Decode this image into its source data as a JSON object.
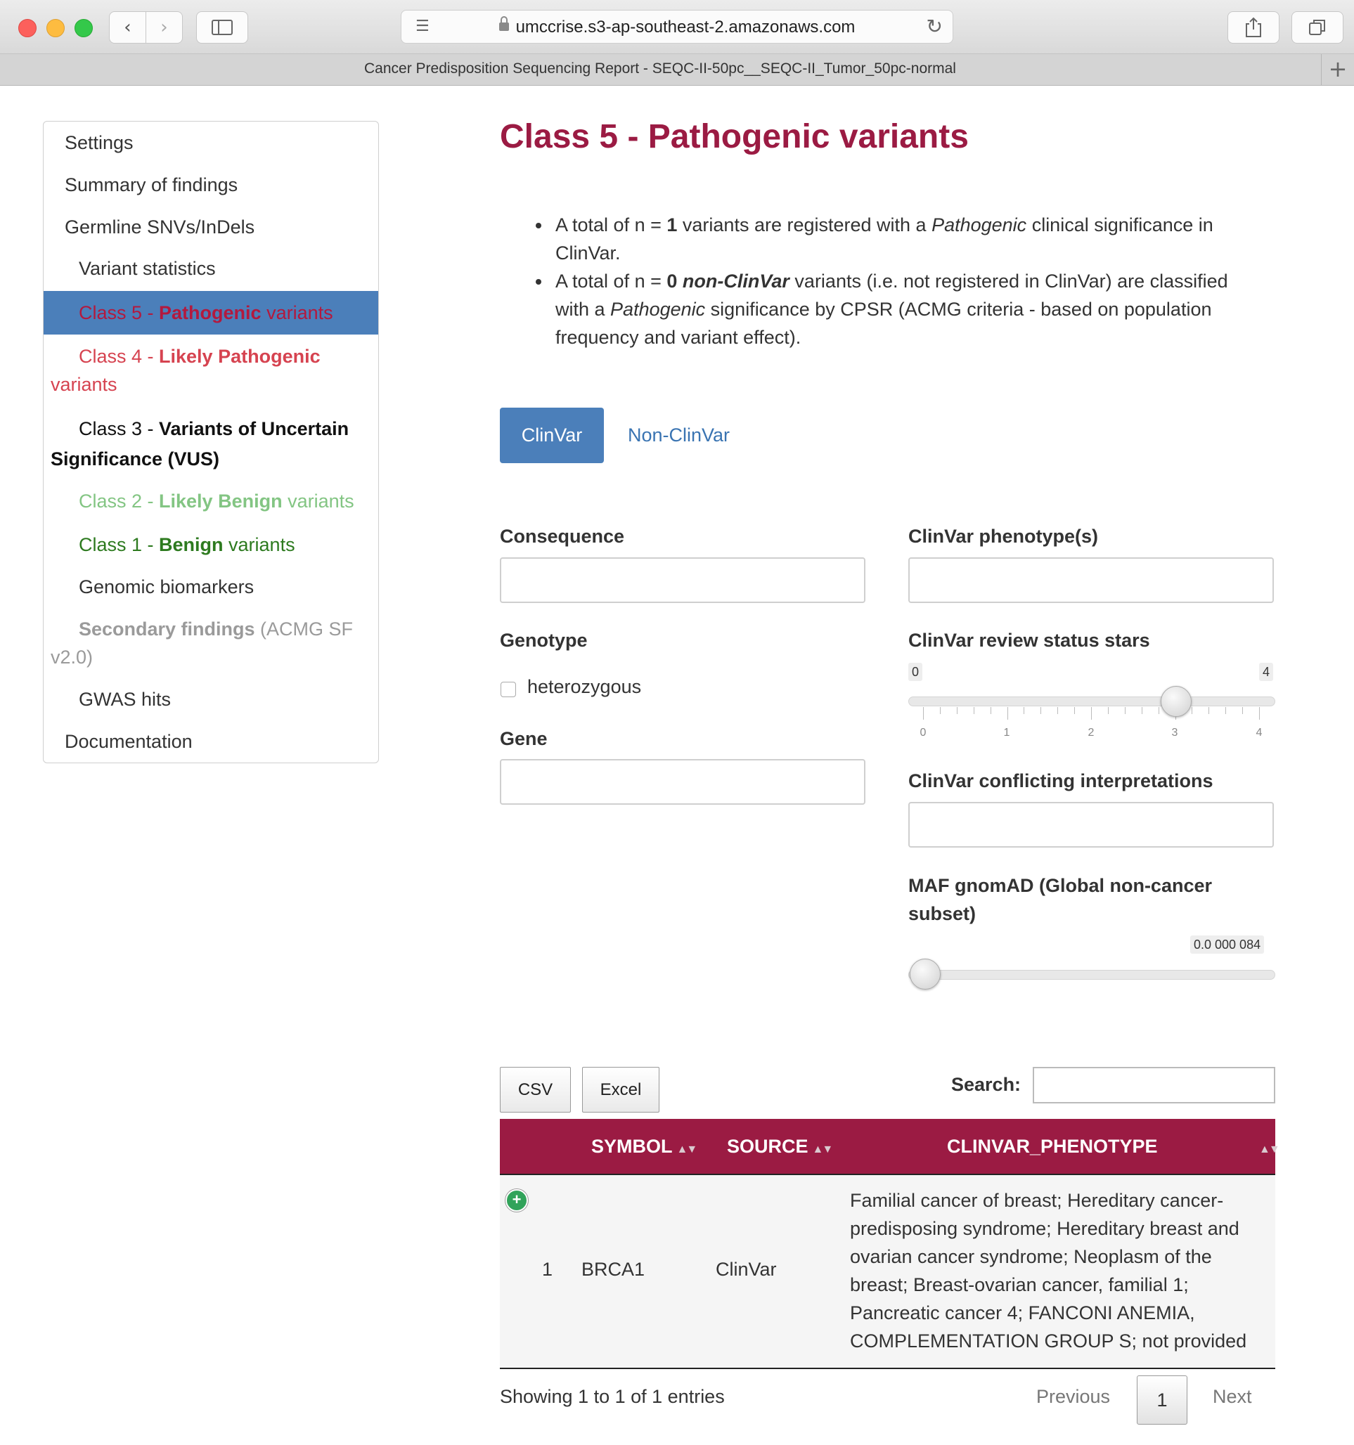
{
  "browser": {
    "url": "umccrise.s3-ap-southeast-2.amazonaws.com",
    "tab_title": "Cancer Predisposition Sequencing Report - SEQC-II-50pc__SEQC-II_Tumor_50pc-normal",
    "new_tab": "+"
  },
  "toc": {
    "settings": "Settings",
    "summary": "Summary of findings",
    "germline": "Germline SNVs/InDels",
    "variant_stats": "Variant statistics",
    "class5": {
      "prefix": "Class 5 - ",
      "bold": "Pathogenic",
      "suffix": " variants"
    },
    "class4": {
      "prefix": "Class 4 - ",
      "bold": "Likely Pathogenic",
      "suffix": " variants"
    },
    "class3": {
      "prefix": "Class 3 - ",
      "bold": "Variants of Uncertain Significance (VUS)"
    },
    "class2": {
      "prefix": "Class 2 - ",
      "bold": "Likely Benign",
      "suffix": " variants"
    },
    "class1": {
      "prefix": "Class 1 - ",
      "bold": "Benign",
      "suffix": " variants"
    },
    "biomarkers": "Genomic biomarkers",
    "secondary": {
      "bold": "Secondary findings",
      "suffix": " (ACMG SF v2.0)"
    },
    "gwas": "GWAS hits",
    "documentation": "Documentation"
  },
  "main": {
    "title": "Class 5 - Pathogenic variants",
    "bullet1": {
      "a": "A total of n = ",
      "n": "1",
      "b": " variants are registered with a ",
      "em": "Pathogenic",
      "c": " clinical significance in ClinVar."
    },
    "bullet2": {
      "a": "A total of n = ",
      "n": "0",
      "b": " ",
      "em": "non-ClinVar",
      "c": " variants (i.e. not registered in ClinVar) are classified with a ",
      "em2": "Pathogenic",
      "d": " significance by CPSR (ACMG criteria - based on population frequency and variant effect)."
    },
    "pills": [
      "ClinVar",
      "Non-ClinVar"
    ]
  },
  "filters": {
    "consequence_label": "Consequence",
    "phenotype_label": "ClinVar phenotype(s)",
    "genotype_label": "Genotype",
    "genotype_option": "heterozygous",
    "gene_label": "Gene",
    "stars_label": "ClinVar review status stars",
    "stars_min": "0",
    "stars_max": "4",
    "stars_value": 3,
    "stars_ticks": [
      "0",
      "1",
      "2",
      "3",
      "4"
    ],
    "conflicting_label": "ClinVar conflicting interpretations",
    "maf_label": "MAF gnomAD (Global non-cancer subset)",
    "maf_value": "0.0 000 084"
  },
  "table": {
    "buttons": [
      "CSV",
      "Excel"
    ],
    "search_label": "Search:",
    "search_value": "",
    "columns": [
      "SYMBOL",
      "SOURCE",
      "CLINVAR_PHENOTYPE"
    ],
    "rows": [
      {
        "index": "1",
        "symbol": "BRCA1",
        "source": "ClinVar",
        "phenotype": "Familial cancer of breast; Hereditary cancer-predisposing syndrome; Hereditary breast and ovarian cancer syndrome; Neoplasm of the breast; Breast-ovarian cancer, familial 1; Pancreatic cancer 4; FANCONI ANEMIA, COMPLEMENTATION GROUP S; not provided"
      }
    ],
    "info": "Showing 1 to 1 of 1 entries",
    "previous": "Previous",
    "page": "1",
    "next": "Next"
  },
  "colors": {
    "accent": "#9b1b43",
    "active_nav": "#4b7fba",
    "class5": "#b3193e",
    "class4": "#d64350",
    "class2": "#83c583",
    "class1": "#2d7a1f"
  }
}
